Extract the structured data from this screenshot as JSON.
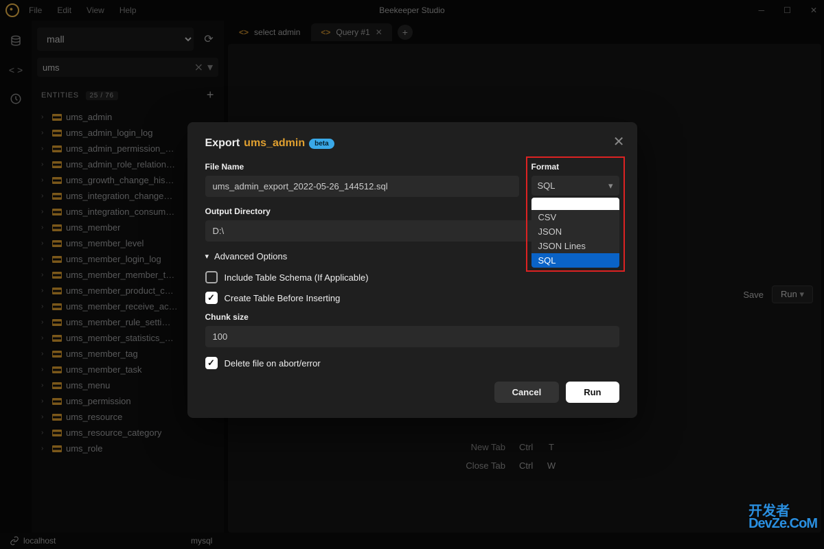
{
  "app": {
    "title": "Beekeeper Studio"
  },
  "menu": {
    "file": "File",
    "edit": "Edit",
    "view": "View",
    "help": "Help"
  },
  "sidebar": {
    "database": "mall",
    "filter": "ums",
    "entities_label": "ENTITIES",
    "entities_count": "25 / 76",
    "items": [
      "ums_admin",
      "ums_admin_login_log",
      "ums_admin_permission_…",
      "ums_admin_role_relation…",
      "ums_growth_change_his…",
      "ums_integration_change…",
      "ums_integration_consum…",
      "ums_member",
      "ums_member_level",
      "ums_member_login_log",
      "ums_member_member_t…",
      "ums_member_product_c…",
      "ums_member_receive_ac…",
      "ums_member_rule_setti…",
      "ums_member_statistics_…",
      "ums_member_tag",
      "ums_member_task",
      "ums_menu",
      "ums_permission",
      "ums_resource",
      "ums_resource_category",
      "ums_role"
    ]
  },
  "tabs": {
    "t1": "select admin",
    "t2": "Query #1"
  },
  "toolbar": {
    "save": "Save",
    "run": "Run"
  },
  "hints": {
    "newtab": "New Tab",
    "closetab": "Close Tab",
    "ctrl": "Ctrl",
    "k1": "T",
    "k2": "W"
  },
  "status": {
    "host": "localhost",
    "engine": "mysql"
  },
  "modal": {
    "title_prefix": "Export",
    "table_name": "ums_admin",
    "beta": "beta",
    "file_name_label": "File Name",
    "file_name": "ums_admin_export_2022-05-26_144512.sql",
    "format_label": "Format",
    "format_value": "SQL",
    "format_options": {
      "csv": "CSV",
      "json": "JSON",
      "jsonl": "JSON Lines",
      "sql": "SQL"
    },
    "outdir_label": "Output Directory",
    "outdir": "D:\\",
    "advanced": "Advanced Options",
    "include_schema": "Include Table Schema (If Applicable)",
    "create_table": "Create Table Before Inserting",
    "chunk_label": "Chunk size",
    "chunk_value": "100",
    "delete_on_abort": "Delete file on abort/error",
    "cancel": "Cancel",
    "run": "Run"
  },
  "watermark": {
    "l1": "开发者",
    "l2": "DevZe.CoM"
  }
}
